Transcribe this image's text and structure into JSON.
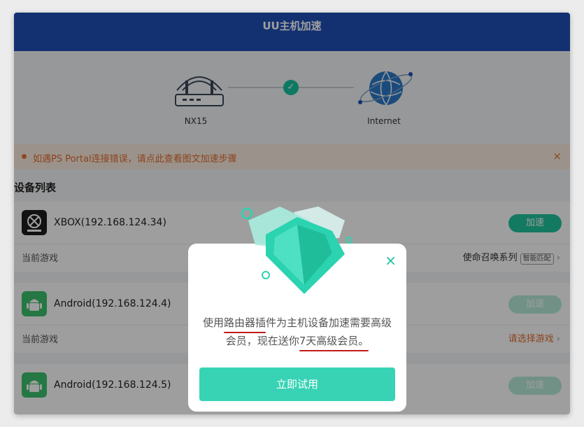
{
  "window": {
    "title": "UU主机加速"
  },
  "network": {
    "router_label": "NX15",
    "internet_label": "Internet",
    "connection_status": "connected"
  },
  "notice": {
    "text": "如遇PS Portal连接错误，请点此查看图文加速步骤",
    "close": "×"
  },
  "devices_section": {
    "title": "设备列表"
  },
  "devices": [
    {
      "name": "XBOX(192.168.124.34)",
      "accelerate": "加速",
      "current_game_label": "当前游戏",
      "current_game": "使命召唤系列",
      "tag": "智能匹配",
      "chevron": "›"
    },
    {
      "name": "Android(192.168.124.4)",
      "accelerate": "加速",
      "current_game_label": "当前游戏",
      "current_game": "请选择游戏",
      "chevron": "›"
    },
    {
      "name": "Android(192.168.124.5)",
      "accelerate": "加速"
    }
  ],
  "dialog": {
    "close": "×",
    "message_part1": "使用",
    "message_highlight1": "路由器插",
    "message_part2": "件为主机设备加速需要高级会员，现在送你",
    "message_highlight2": "7天高级会员。",
    "trial_button": "立即试用"
  },
  "colors": {
    "brand": "#1f4fb6",
    "accent": "#17c3a0",
    "warning": "#e36b2f"
  }
}
